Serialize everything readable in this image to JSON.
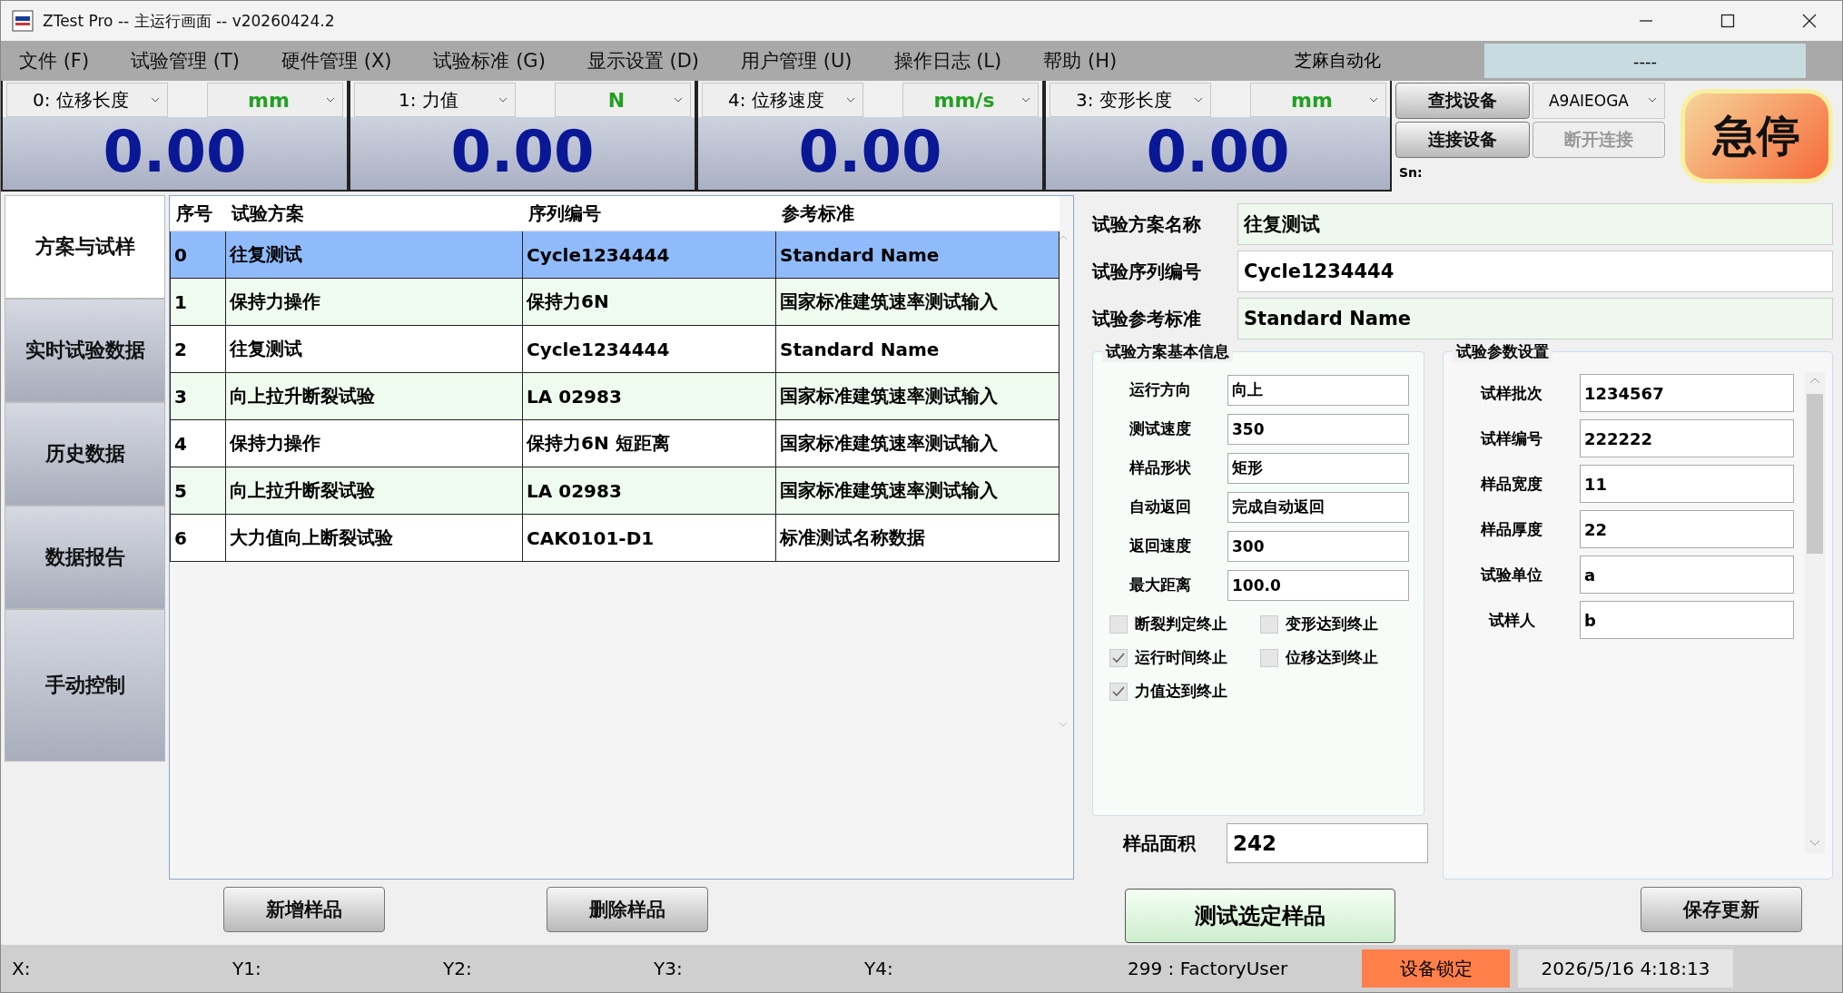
{
  "window": {
    "title": "ZTest Pro  --  主运行画面  --  v20260424.2"
  },
  "menu": [
    "文件 (F)",
    "试验管理 (T)",
    "硬件管理 (X)",
    "试验标准 (G)",
    "显示设置 (D)",
    "用户管理 (U)",
    "操作日志 (L)",
    "帮助 (H)"
  ],
  "company": "芝麻自动化",
  "status_display": "----",
  "readouts": [
    {
      "channel": "0: 位移长度",
      "unit": "mm",
      "value": "0.00"
    },
    {
      "channel": "1: 力值",
      "unit": "N",
      "value": "0.00"
    },
    {
      "channel": "4: 位移速度",
      "unit": "mm/s",
      "value": "0.00"
    },
    {
      "channel": "3: 变形长度",
      "unit": "mm",
      "value": "0.00"
    }
  ],
  "device": {
    "find_button": "查找设备",
    "connect_button": "连接设备",
    "disconnect_button": {
      "label": "断开连接",
      "disabled": true
    },
    "port": "A9AIEOGA",
    "sn_label": "Sn:"
  },
  "emergency_stop": "急停",
  "sidebar": [
    {
      "label": "方案与试样",
      "selected": true
    },
    {
      "label": "实时试验数据",
      "selected": false
    },
    {
      "label": "历史数据",
      "selected": false
    },
    {
      "label": "数据报告",
      "selected": false
    },
    {
      "label": "手动控制",
      "selected": false
    }
  ],
  "table": {
    "columns": [
      "序号",
      "试验方案",
      "序列编号",
      "参考标准"
    ],
    "rows": [
      {
        "cells": [
          "0",
          "往复测试",
          "Cycle1234444",
          "Standard Name"
        ],
        "selected": true
      },
      {
        "cells": [
          "1",
          "保持力操作",
          "保持力6N",
          "国家标准建筑速率测试输入"
        ],
        "selected": false
      },
      {
        "cells": [
          "2",
          "往复测试",
          "Cycle1234444",
          "Standard Name"
        ],
        "selected": false
      },
      {
        "cells": [
          "3",
          "向上拉升断裂试验",
          "LA 02983",
          "国家标准建筑速率测试输入"
        ],
        "selected": false
      },
      {
        "cells": [
          "4",
          "保持力操作",
          "保持力6N 短距离",
          "国家标准建筑速率测试输入"
        ],
        "selected": false
      },
      {
        "cells": [
          "5",
          "向上拉升断裂试验",
          "LA 02983",
          "国家标准建筑速率测试输入"
        ],
        "selected": false
      },
      {
        "cells": [
          "6",
          "大力值向上断裂试验",
          "CAK0101-D1",
          "标准测试名称数据"
        ],
        "selected": false
      }
    ]
  },
  "table_buttons": [
    "新增样品",
    "删除样品"
  ],
  "plan_fields": [
    {
      "label": "试验方案名称",
      "value": "往复测试",
      "readonly": true
    },
    {
      "label": "试验序列编号",
      "value": "Cycle1234444",
      "readonly": false
    },
    {
      "label": "试验参考标准",
      "value": "Standard Name",
      "readonly": true
    }
  ],
  "basic_info": {
    "title": "试验方案基本信息",
    "fields": [
      {
        "label": "运行方向",
        "value": "向上"
      },
      {
        "label": "测试速度",
        "value": "350"
      },
      {
        "label": "样品形状",
        "value": "矩形"
      },
      {
        "label": "自动返回",
        "value": "完成自动返回"
      },
      {
        "label": "返回速度",
        "value": "300"
      },
      {
        "label": "最大距离",
        "value": "100.0"
      }
    ],
    "checkboxes": [
      {
        "label": "断裂判定终止",
        "checked": false
      },
      {
        "label": "变形达到终止",
        "checked": false
      },
      {
        "label": "运行时间终止",
        "checked": true
      },
      {
        "label": "位移达到终止",
        "checked": false
      },
      {
        "label": "力值达到终止",
        "checked": true
      }
    ]
  },
  "params": {
    "title": "试验参数设置",
    "fields": [
      {
        "label": "试样批次",
        "value": "1234567"
      },
      {
        "label": "试样编号",
        "value": "222222"
      },
      {
        "label": "样品宽度",
        "value": "11"
      },
      {
        "label": "样品厚度",
        "value": "22"
      },
      {
        "label": "试验单位",
        "value": "a"
      },
      {
        "label": "试样人",
        "value": "b"
      }
    ]
  },
  "area": {
    "label": "样品面积",
    "value": "242"
  },
  "test_button": "测试选定样品",
  "save_button": "保存更新",
  "status_bar": {
    "coords": [
      "X:",
      "Y1:",
      "Y2:",
      "Y3:",
      "Y4:"
    ],
    "user": "299 : FactoryUser",
    "lock": "设备锁定",
    "datetime": "2026/5/16 4:18:13"
  }
}
